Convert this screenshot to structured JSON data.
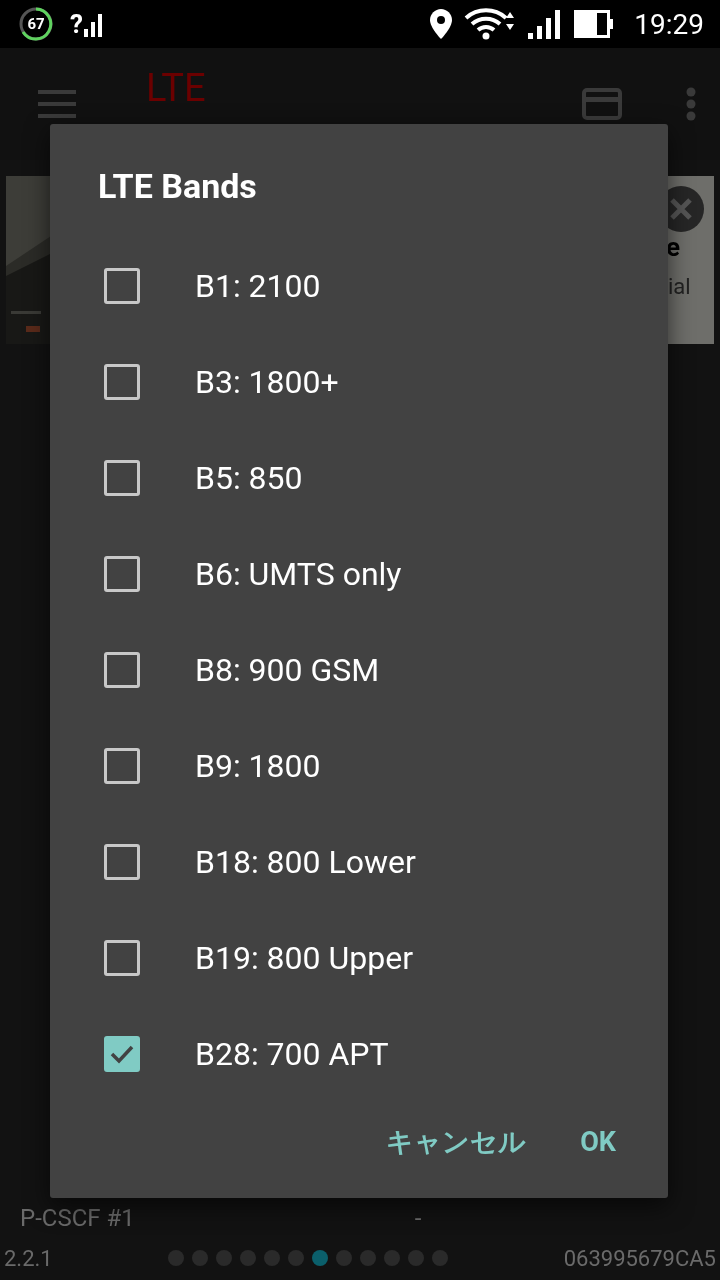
{
  "status_bar": {
    "data_saver_count": "67",
    "sim_mark": "?",
    "time": "19:29"
  },
  "app_bar": {
    "title": "LTE"
  },
  "ad": {
    "text_1": "e",
    "text_2": "ial"
  },
  "info_row": {
    "label": "P-CSCF #1",
    "value": "-"
  },
  "footer": {
    "version": "2.2.1",
    "code": "063995679CA5",
    "pages": [
      {
        "selected": false
      },
      {
        "selected": false
      },
      {
        "selected": false
      },
      {
        "selected": false
      },
      {
        "selected": false
      },
      {
        "selected": false
      },
      {
        "selected": true
      },
      {
        "selected": false
      },
      {
        "selected": false
      },
      {
        "selected": false
      },
      {
        "selected": false
      },
      {
        "selected": false
      }
    ]
  },
  "dialog": {
    "title": "LTE Bands",
    "options": [
      {
        "label": "B1: 2100",
        "checked": false
      },
      {
        "label": "B3: 1800+",
        "checked": false
      },
      {
        "label": "B5: 850",
        "checked": false
      },
      {
        "label": "B6: UMTS only",
        "checked": false
      },
      {
        "label": "B8: 900 GSM",
        "checked": false
      },
      {
        "label": "B9: 1800",
        "checked": false
      },
      {
        "label": "B18: 800 Lower",
        "checked": false
      },
      {
        "label": "B19: 800 Upper",
        "checked": false
      },
      {
        "label": "B28: 700 APT",
        "checked": true
      }
    ],
    "buttons": [
      "キャンセル",
      "OK"
    ]
  }
}
